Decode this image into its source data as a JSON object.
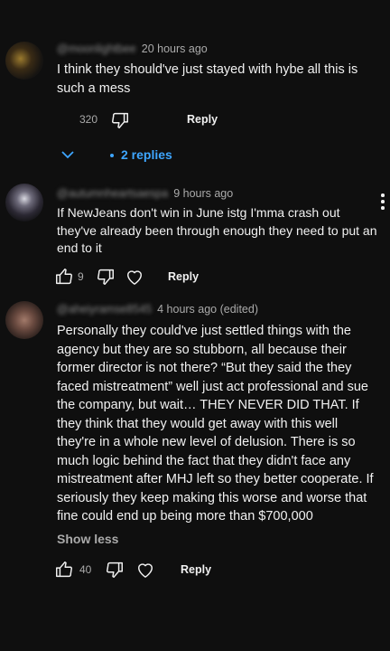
{
  "comments": [
    {
      "handle": "@moonlightbee",
      "time": "20 hours ago",
      "text": "I think they should've just stayed with hybe all this is such a mess",
      "likes": "320",
      "reply_label": "Reply",
      "replies_label": "2 replies"
    },
    {
      "handle": "@autumnheartsaespa",
      "time": "9 hours ago",
      "text": "If NewJeans don't win in June istg I'mma crash out they've already been through enough they need to put an end to it",
      "likes": "9",
      "reply_label": "Reply"
    },
    {
      "handle": "@aheiyramse8545",
      "time": "4 hours ago (edited)",
      "text": "Personally they could've just settled things with the agency but they are so stubborn, all because their former director is not there? “But they said the they faced mistreatment” well just act professional and sue the company, but wait… THEY NEVER DID THAT. If they think that they would get away with this well they're in a whole new level of delusion. There is so much logic behind the fact that they didn't face any mistreatment after MHJ left so they better cooperate. If seriously they keep making this worse and worse that fine could end up being more than $700,000",
      "show_less_label": "Show less",
      "likes": "40",
      "reply_label": "Reply"
    }
  ],
  "icons": {
    "like": "thumbs-up-icon",
    "dislike": "thumbs-down-icon",
    "heart": "heart-icon",
    "expand": "chevron-down-icon",
    "menu": "kebab-menu-icon"
  },
  "colors": {
    "background": "#0f0f0f",
    "text": "#f1f1f1",
    "muted": "#aaaaaa",
    "link": "#3ea6ff"
  }
}
